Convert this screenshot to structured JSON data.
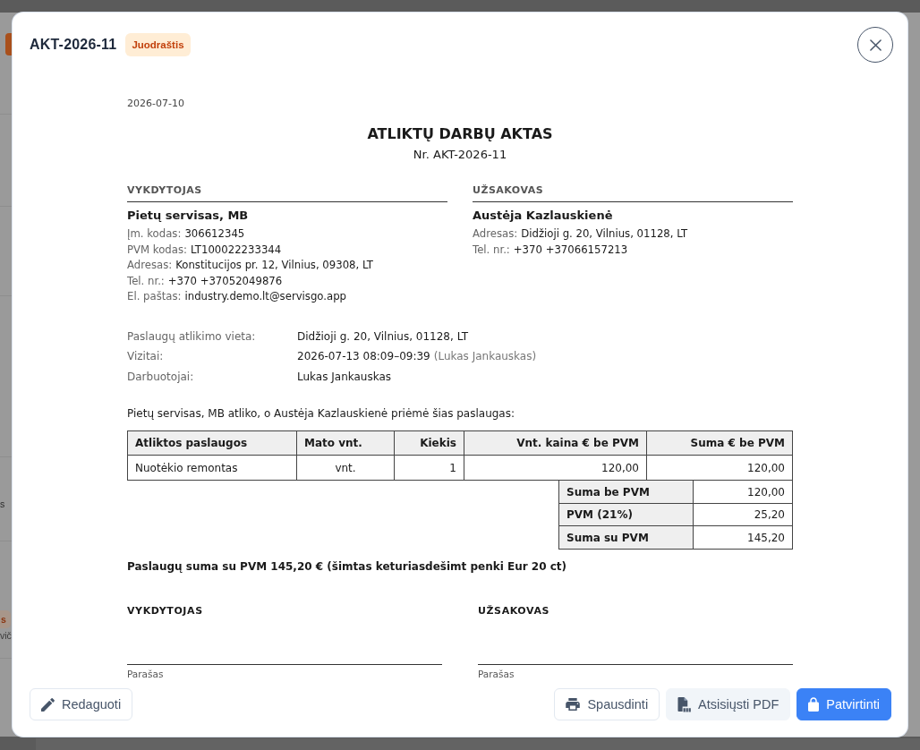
{
  "backdrop": {
    "side_texts": [
      {
        "kind": "text",
        "text": "s"
      },
      {
        "kind": "badge",
        "text": "s"
      },
      {
        "kind": "text",
        "text": "vič"
      }
    ]
  },
  "dialog": {
    "title": "AKT-2026-11",
    "status_badge": "Juodraštis"
  },
  "document": {
    "date": "2026-07-10",
    "title": "ATLIKTŲ DARBŲ AKTAS",
    "number": "Nr. AKT-2026-11",
    "parties": [
      {
        "heading": "VYKDYTOJAS",
        "name": "Pietų servisas, MB",
        "fields": [
          {
            "label": "Įm. kodas:",
            "value": "306612345"
          },
          {
            "label": "PVM kodas:",
            "value": "LT100022233344"
          },
          {
            "label": "Adresas:",
            "value": "Konstitucijos pr. 12, Vilnius, 09308, LT"
          },
          {
            "label": "Tel. nr.:",
            "value": "+370 +37052049876"
          },
          {
            "label": "El. paštas:",
            "value": "industry.demo.lt@servisgo.app"
          }
        ]
      },
      {
        "heading": "UŽSAKOVAS",
        "name": "Austėja Kazlauskienė",
        "fields": [
          {
            "label": "Adresas:",
            "value": "Didžioji g. 20, Vilnius, 01128, LT"
          },
          {
            "label": "Tel. nr.:",
            "value": "+370 +37066157213"
          }
        ]
      }
    ],
    "details": [
      {
        "label": "Paslaugų atlikimo vieta:",
        "value": "Didžioji g. 20, Vilnius, 01128, LT"
      },
      {
        "label": "Vizitai:",
        "value": "2026-07-13 08:09–09:39",
        "note": "(Lukas Jankauskas)"
      },
      {
        "label": "Darbuotojai:",
        "value": "Lukas Jankauskas"
      }
    ],
    "intro": "Pietų servisas, MB atliko, o Austėja Kazlauskienė priėmė šias paslaugas:",
    "table": {
      "columns": [
        "Atliktos paslaugos",
        "Mato vnt.",
        "Kiekis",
        "Vnt. kaina € be PVM",
        "Suma € be PVM"
      ],
      "rows": [
        [
          "Nuotėkio remontas",
          "vnt.",
          "1",
          "120,00",
          "120,00"
        ]
      ]
    },
    "totals": [
      {
        "label": "Suma be PVM",
        "value": "120,00"
      },
      {
        "label": "PVM (21%)",
        "value": "25,20"
      },
      {
        "label": "Suma su PVM",
        "value": "145,20"
      }
    ],
    "total_summary": "Paslaugų suma su PVM 145,20 € (šimtas keturiasdešimt penki Eur 20 ct)",
    "signatures": [
      {
        "heading": "VYKDYTOJAS",
        "caption": "Parašas"
      },
      {
        "heading": "UŽSAKOVAS",
        "caption": "Parašas"
      }
    ]
  },
  "footer": {
    "left_buttons": [
      {
        "kind": "edit",
        "label": "Redaguoti"
      }
    ],
    "right_buttons": [
      {
        "kind": "print",
        "label": "Spausdinti"
      },
      {
        "kind": "pdf",
        "label": "Atsisiųsti PDF"
      },
      {
        "kind": "confirm",
        "label": "Patvirtinti"
      }
    ]
  }
}
